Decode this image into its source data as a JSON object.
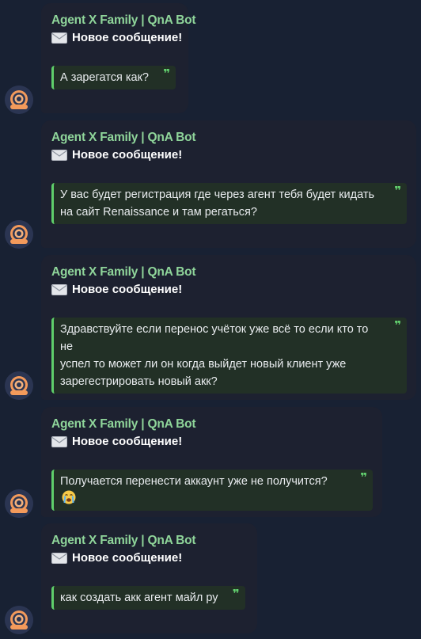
{
  "messages": [
    {
      "sender": "Agent X Family | QnA Bot",
      "header": "Новое сообщение!",
      "header_icon": "envelope-icon",
      "quote": "А зарегатся как?",
      "quote_mark": "❞"
    },
    {
      "sender": "Agent X Family | QnA Bot",
      "header": "Новое сообщение!",
      "header_icon": "envelope-icon",
      "quote_lines": [
        "У вас будет регистрация где через агент тебя будет кидать",
        "на сайт Renaissance и там регаться?"
      ],
      "quote_mark": "❞"
    },
    {
      "sender": "Agent X Family | QnA Bot",
      "header": "Новое сообщение!",
      "header_icon": "envelope-icon",
      "quote_lines": [
        "Здравствуйте если перенос учёток уже всё то если кто то не",
        "успел то может ли он когда выйдет новый клиент уже",
        "зарегестрировать новый акк?"
      ],
      "quote_mark": "❞"
    },
    {
      "sender": "Agent X Family | QnA Bot",
      "header": "Новое сообщение!",
      "header_icon": "envelope-icon",
      "quote": "Получается перенести аккаунт уже не получится?",
      "quote_emoji": "loudly-crying-face-emoji",
      "quote_mark": "❞"
    },
    {
      "sender": "Agent X Family | QnA Bot",
      "header": "Новое сообщение!",
      "header_icon": "envelope-icon",
      "quote": "как создать акк агент майл ру",
      "quote_mark": "❞"
    }
  ],
  "avatar_icon": "bot-avatar-icon",
  "colors": {
    "background": "#182133",
    "bubble": "#1d2130",
    "sender": "#8fd59a",
    "quote_bar": "#5fcf6a",
    "quote_bg": "#223026"
  }
}
